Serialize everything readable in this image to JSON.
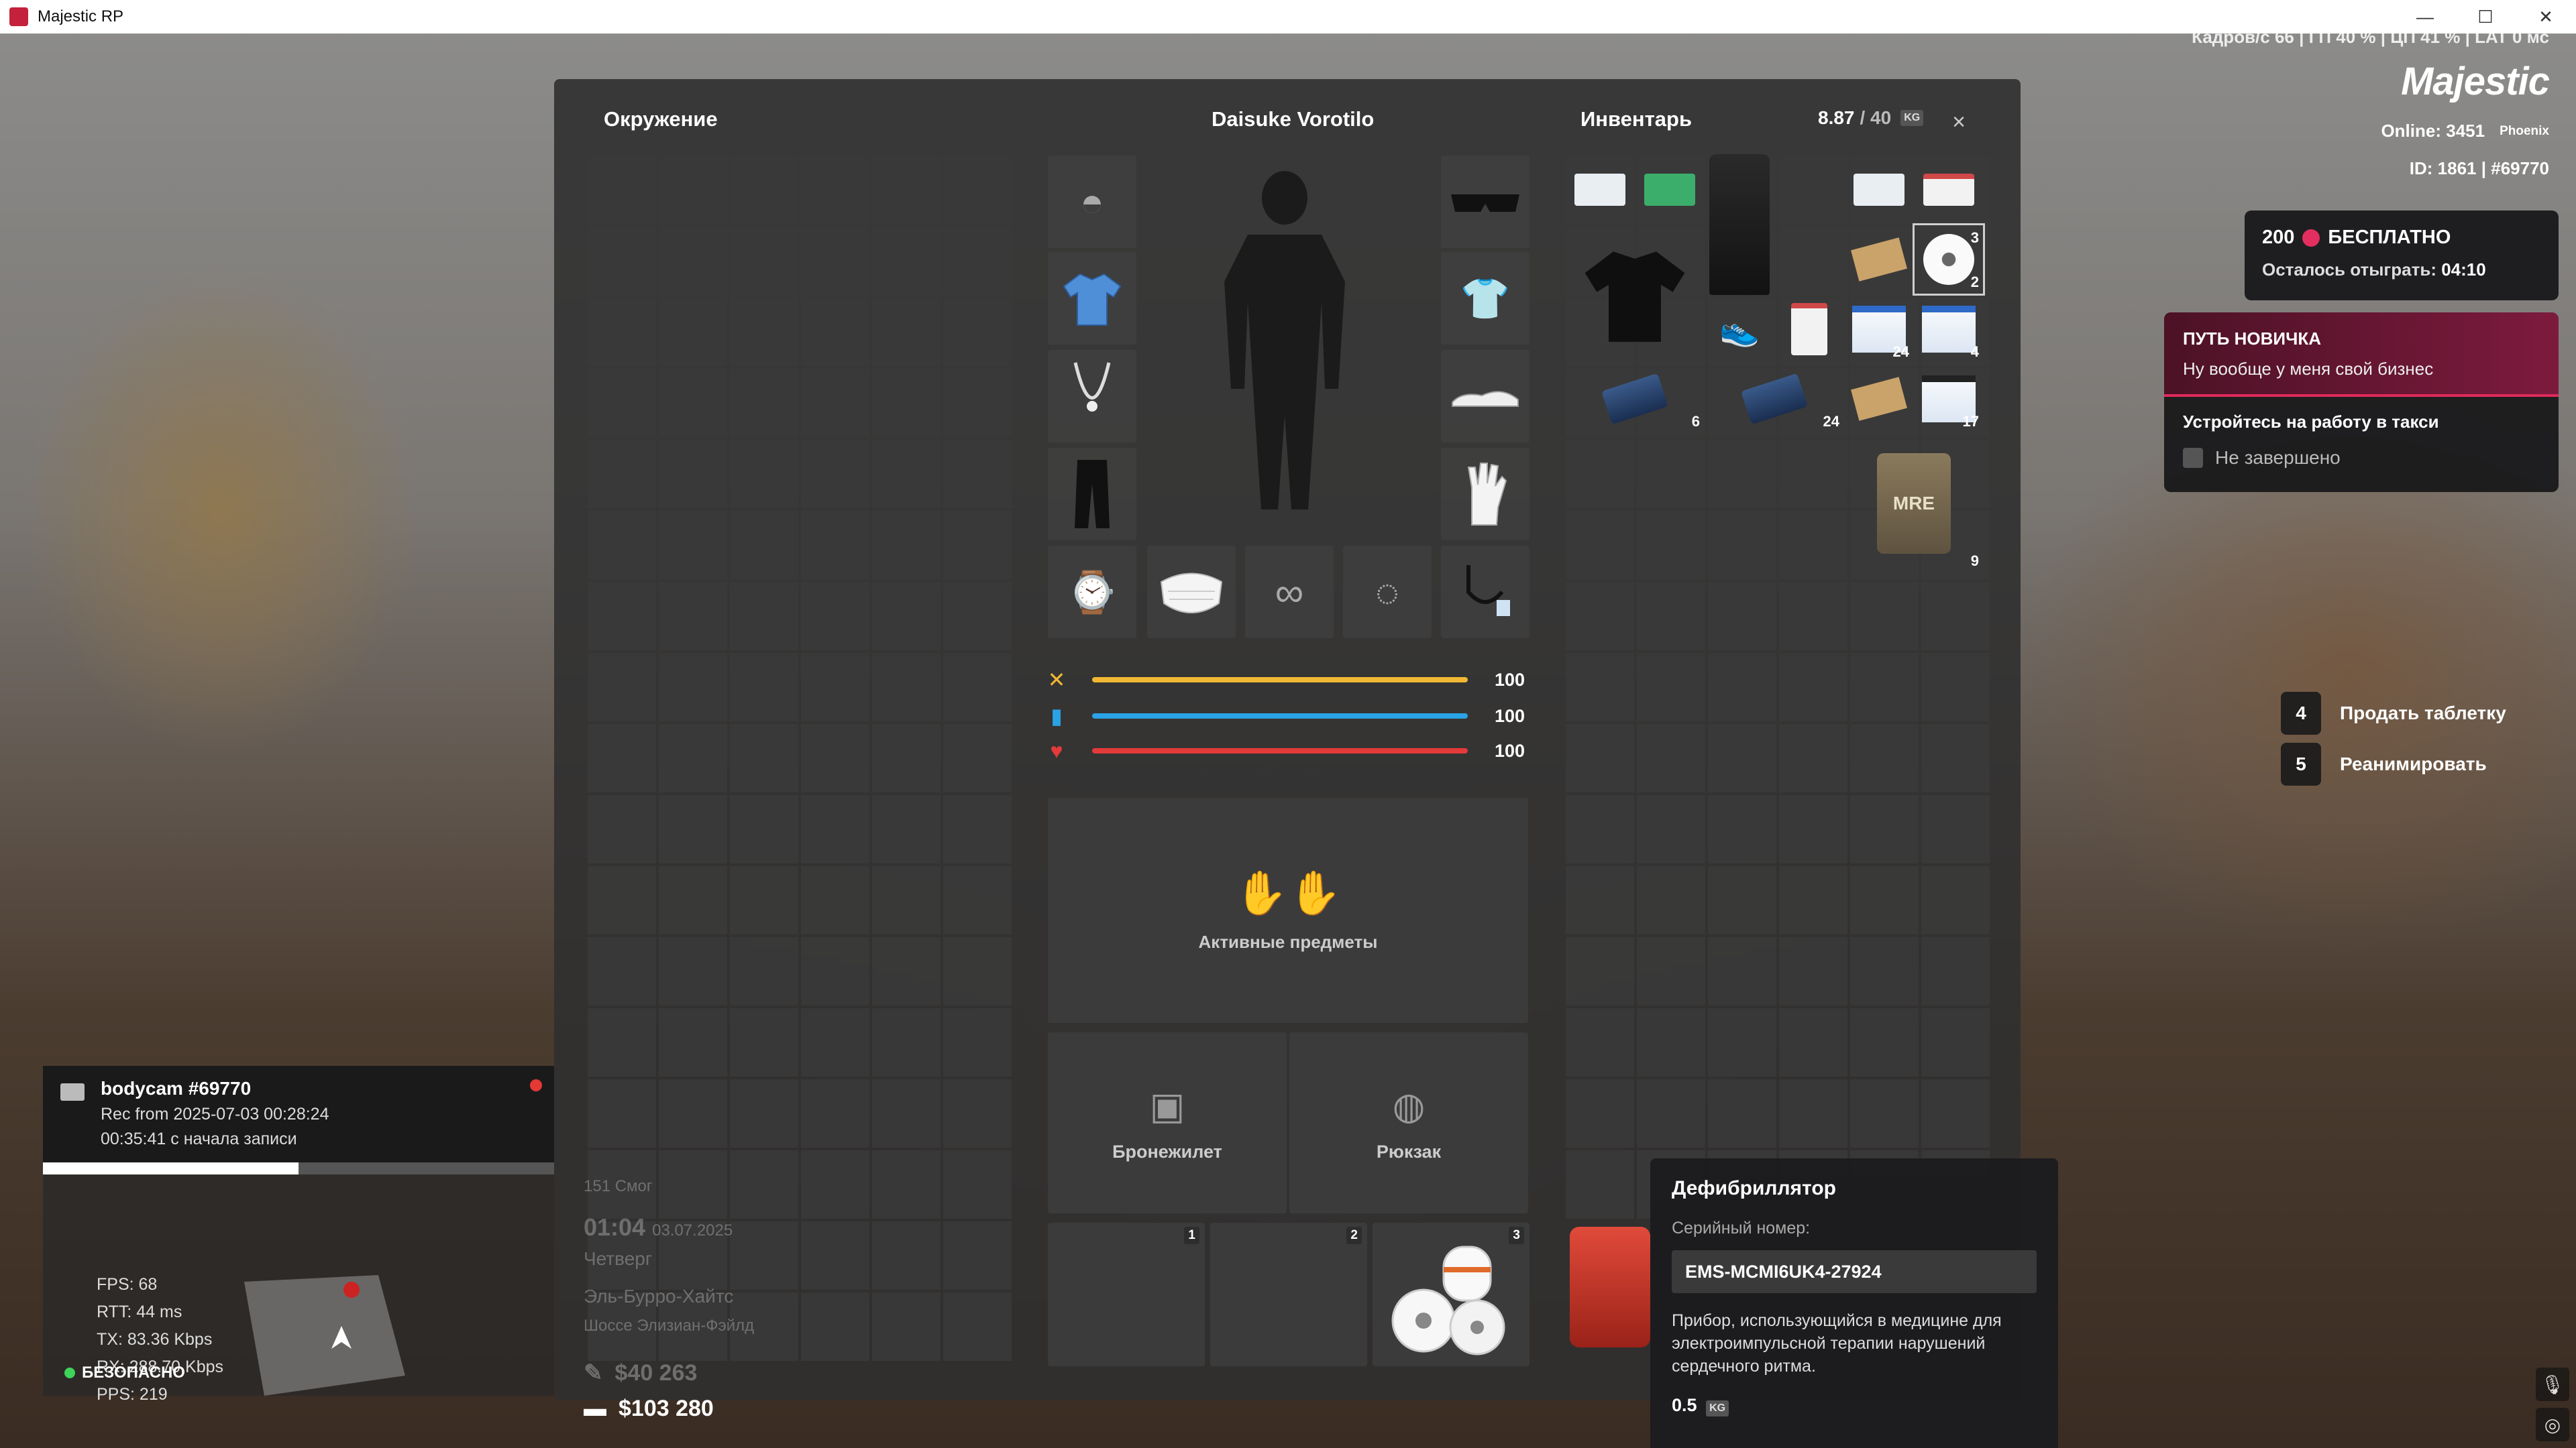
{
  "window": {
    "title": "Majestic RP",
    "minimize": "—",
    "maximize": "☐",
    "close": "✕"
  },
  "hud": {
    "top_stats": "Кадров/с 66 | ГП 40 % | ЦП 41 % | LAT 0 мс",
    "logo": "Majestic",
    "online_label": "Online:",
    "online_value": "3451",
    "server": "Phoenix",
    "id_label": "ID: 1861 | #69770"
  },
  "promo": {
    "amount": "200",
    "label": "БЕСПЛАТНО",
    "remaining_label": "Осталось отыграть:",
    "remaining_value": "04:10"
  },
  "quest": {
    "header": "ПУТЬ НОВИЧКА",
    "subtitle": "Ну вообще у меня свой бизнес",
    "task": "Устройтесь на работу в такси",
    "status": "Не завершено"
  },
  "actions": [
    {
      "key": "4",
      "label": "Продать таблетку"
    },
    {
      "key": "5",
      "label": "Реанимировать"
    }
  ],
  "inventory": {
    "env_title": "Окружение",
    "character_name": "Daisuke Vorotilo",
    "inv_title": "Инвентарь",
    "weight_current": "8.87",
    "weight_max": "/ 40",
    "weight_unit": "KG",
    "close": "×",
    "stats": [
      {
        "icon": "food-icon",
        "value": 100,
        "color": "#f0b833"
      },
      {
        "icon": "water-icon",
        "value": 100,
        "color": "#2aa3e6"
      },
      {
        "icon": "health-icon",
        "value": 100,
        "color": "#e53a3a"
      }
    ],
    "active_items_label": "Активные предметы",
    "armor_label": "Бронежилет",
    "backpack_label": "Рюкзак",
    "quick_slots": [
      "1",
      "2",
      "3"
    ],
    "item_counts": {
      "roll_small": "2",
      "roll_stack": "3",
      "box_a": "24",
      "box_b": "4",
      "tabs_a": "6",
      "tabs_b": "24",
      "kit": "17",
      "mre": "9"
    },
    "mre_label": "MRE"
  },
  "tooltip": {
    "title": "Дефибриллятор",
    "serial_label": "Серийный номер:",
    "serial": "EMS-MCMI6UK4-27924",
    "description": "Прибор, использующийся в медицине для электроимпульсной терапии нарушений сердечного ритма.",
    "weight": "0.5",
    "unit": "KG"
  },
  "bodycam": {
    "title": "bodycam #69770",
    "rec_line": "Rec from 2025-07-03 00:28:24",
    "elapsed": "00:35:41 с начала записи",
    "progress": 0.5
  },
  "net": {
    "fps": "FPS:  68",
    "rtt": "RTT:  44 ms",
    "tx": "TX:   83.36 Kbps",
    "rx": "RX:   288.70 Kbps",
    "pps": "PPS:  219"
  },
  "safe_label": "БЕЗОПАСНО",
  "world": {
    "street": "151  Смог",
    "time": "01:04",
    "date": "03.07.2025",
    "day": "Четверг",
    "area": "Эль-Бурро-Хайтс",
    "road": "Шоссе Элизиан-Фэйлд",
    "cash": "$40 263",
    "bank": "$103 280"
  }
}
